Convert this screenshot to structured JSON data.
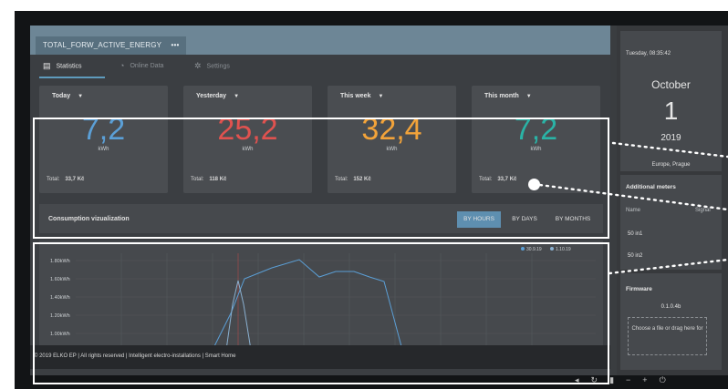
{
  "app": {
    "title_tab": "TOTAL_FORW_ACTIVE_ENERGY",
    "title_menu": "•••",
    "tabs": [
      {
        "label": "Statistics",
        "icon": "chart-icon"
      },
      {
        "label": "Online Data",
        "icon": "clock-icon"
      },
      {
        "label": "Settings",
        "icon": "gear-icon"
      }
    ]
  },
  "cards": [
    {
      "period": "Today",
      "value": "7,2",
      "unit": "kWh",
      "total_label": "Total:",
      "total_value": "33,7 Kč",
      "color": "#5b9fd6"
    },
    {
      "period": "Yesterday",
      "value": "25,2",
      "unit": "kWh",
      "total_label": "Total:",
      "total_value": "118 Kč",
      "color": "#e0524f"
    },
    {
      "period": "This week",
      "value": "32,4",
      "unit": "kWh",
      "total_label": "Total:",
      "total_value": "152 Kč",
      "color": "#f2a33a"
    },
    {
      "period": "This month",
      "value": "7,2",
      "unit": "kWh",
      "total_label": "Total:",
      "total_value": "33,7 Kč",
      "color": "#2ab3a6"
    }
  ],
  "visualization": {
    "label": "Consumption vizualization",
    "buttons": [
      "BY HOURS",
      "BY DAYS",
      "BY MONTHS"
    ],
    "active": "BY HOURS"
  },
  "chart_data": {
    "type": "line",
    "y_ticks": [
      "1.80kWh",
      "1.60kWh",
      "1.40kWh",
      "1.20kWh",
      "1.00kWh"
    ],
    "series": [
      {
        "name": "30.9.19",
        "color": "#5b9fd6"
      },
      {
        "name": "1.10.19",
        "color": "#8ab0d0"
      }
    ]
  },
  "footer": {
    "text": "© 2019 ELKO EP | All rights reserved | Intelligent electro-installations | Smart Home"
  },
  "sidebar": {
    "datetime": "Tuesday, 08:35:42",
    "month": "October",
    "day": "1",
    "year": "2019",
    "timezone": "Europe, Prague",
    "meters_title": "Additional meters",
    "meters_col_name": "Name",
    "meters_col_signal": "Signal",
    "meters": [
      "50 in1",
      "50 in2"
    ],
    "firmware_title": "Firmware",
    "firmware_version": "0.1.0.4b",
    "dropzone_text": "Choose a file or drag here for"
  }
}
